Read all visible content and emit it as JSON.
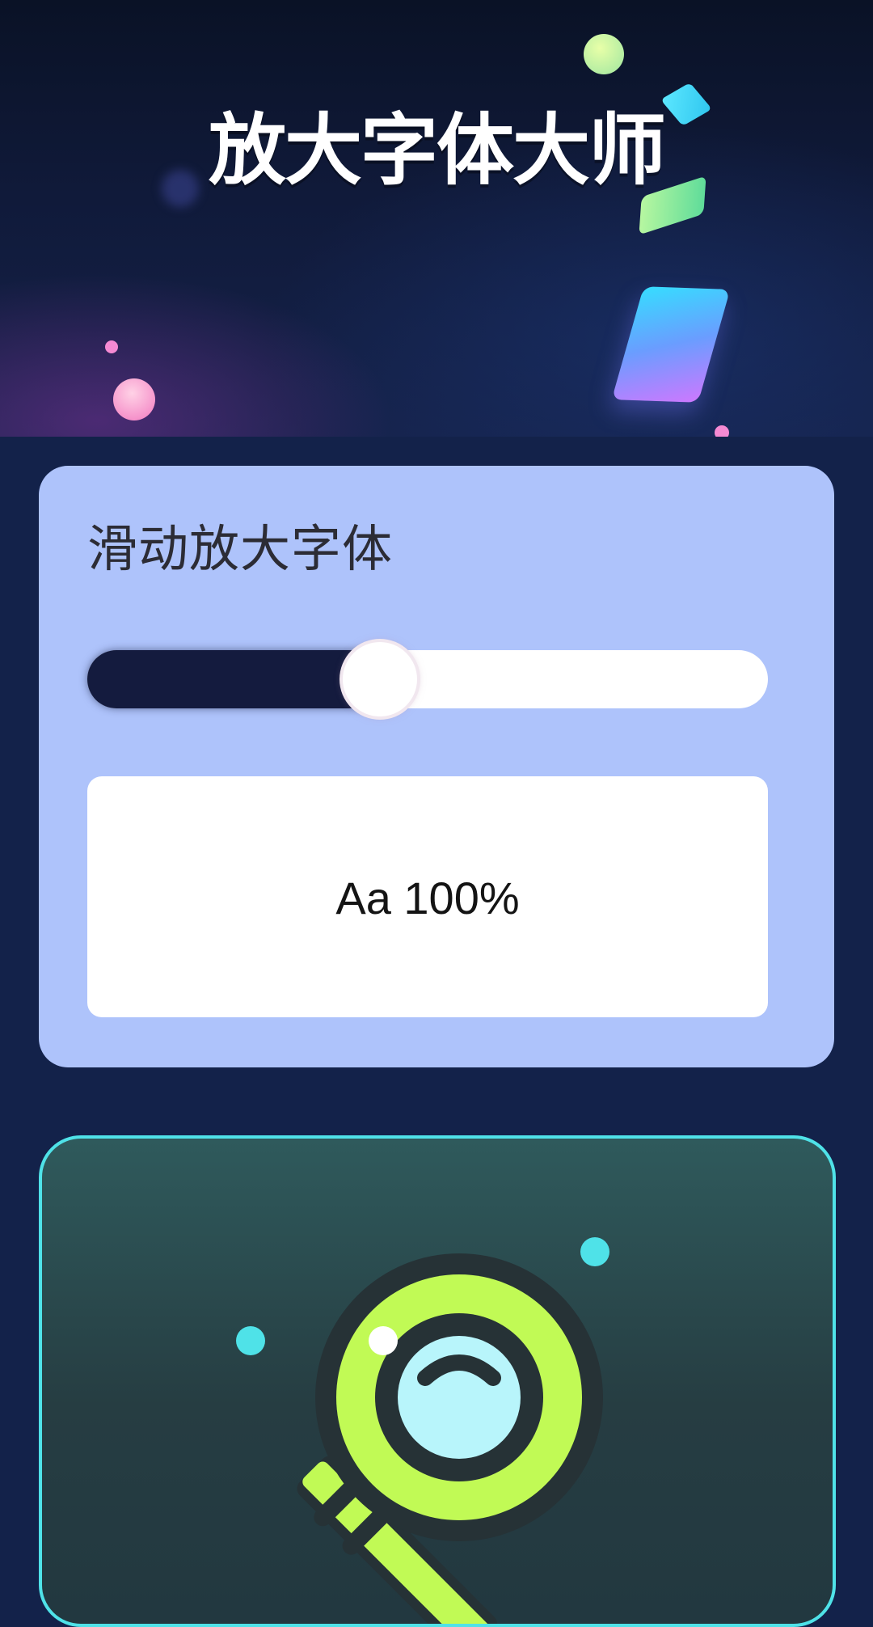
{
  "header": {
    "title": "放大字体大师"
  },
  "font_card": {
    "title": "滑动放大字体",
    "slider": {
      "value": 0.43
    },
    "preview": {
      "text": "Aa 100%"
    }
  },
  "illustration": {
    "icon": "magnifier-icon"
  },
  "colors": {
    "card_bg": "#aec3fb",
    "slider_fill": "#141b3e",
    "accent_cyan": "#4fe2e8",
    "magnifier_lime": "#c1fa55"
  }
}
